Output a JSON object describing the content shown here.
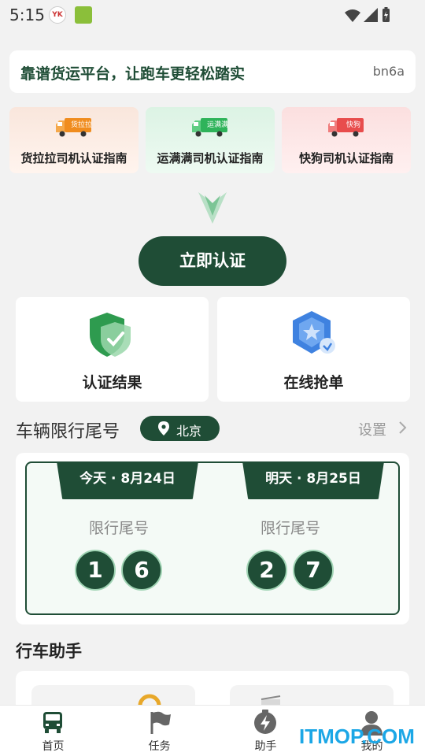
{
  "status_bar": {
    "time": "5:15",
    "app1_glyph": "YK"
  },
  "banner": {
    "text": "靠谱货运平台，让跑车更轻松踏实",
    "code": "bn6a"
  },
  "guides": [
    {
      "badge": "货拉拉",
      "label": "货拉拉司机认证指南",
      "color": "#f08c1e"
    },
    {
      "badge": "运满满",
      "label": "运满满司机认证指南",
      "color": "#2fb35a"
    },
    {
      "badge": "快狗",
      "label": "快狗司机认证指南",
      "color": "#e84c4c"
    }
  ],
  "cert_button": "立即认证",
  "features": [
    {
      "label": "认证结果",
      "icon": "shield-check-icon"
    },
    {
      "label": "在线抢单",
      "icon": "badge-star-icon"
    }
  ],
  "restriction": {
    "title": "车辆限行尾号",
    "city": "北京",
    "settings": "设置",
    "days": [
      {
        "tab": "今天 · 8月24日",
        "label": "限行尾号",
        "digits": [
          "1",
          "6"
        ]
      },
      {
        "tab": "明天 · 8月25日",
        "label": "限行尾号",
        "digits": [
          "2",
          "7"
        ]
      }
    ]
  },
  "assistant": {
    "title": "行车助手"
  },
  "nav": [
    {
      "label": "首页",
      "icon": "truck-icon",
      "active": true
    },
    {
      "label": "任务",
      "icon": "flag-icon",
      "active": false
    },
    {
      "label": "助手",
      "icon": "bolt-icon",
      "active": false
    },
    {
      "label": "我的",
      "icon": "person-icon",
      "active": false
    }
  ],
  "watermark": "ITMOP.COM",
  "colors": {
    "primary": "#1f4d36",
    "background": "#f2f2f2"
  }
}
